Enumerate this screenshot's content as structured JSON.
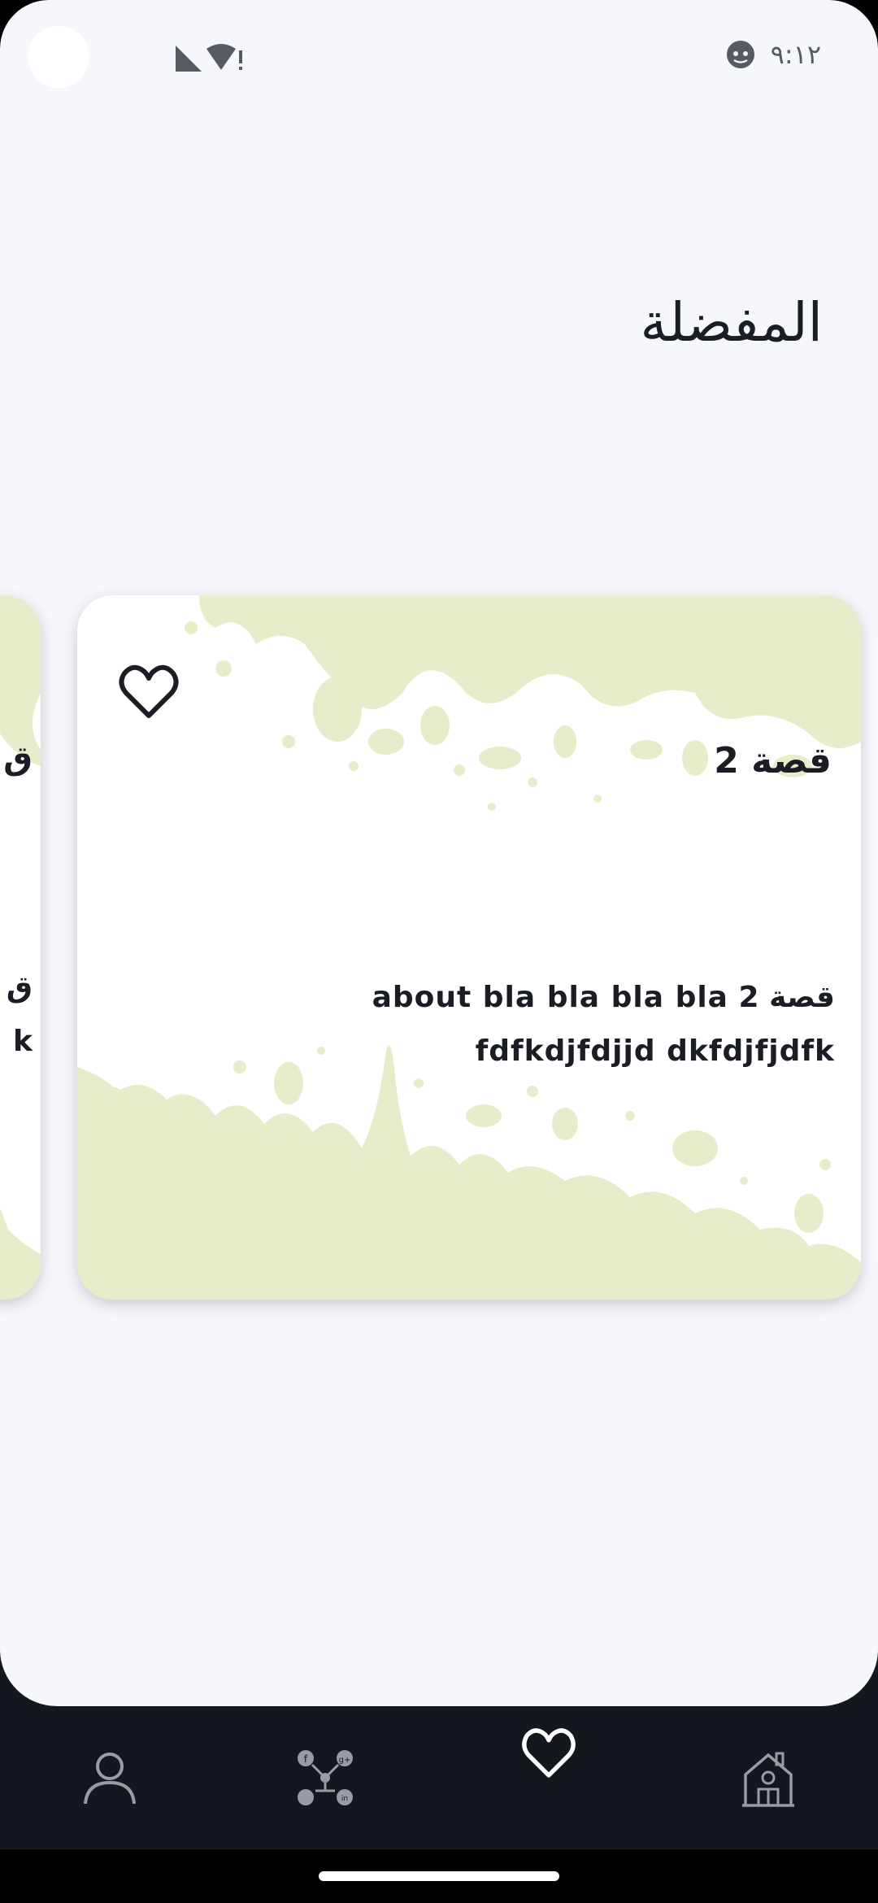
{
  "status_bar": {
    "time": "٩:١٢",
    "icons": [
      "signal-icon",
      "wifi-alert-icon",
      "face-icon"
    ]
  },
  "page": {
    "title": "المفضلة"
  },
  "cards": [
    {
      "title": "قصة 2",
      "description": "قصة 2 about bla bla bla bla fdfkdjfdjjd dkfdjfjdfk",
      "favorited": true
    }
  ],
  "peek_card": {
    "title_fragment": "ق",
    "desc_fragment_1": "ق",
    "desc_fragment_2": "k"
  },
  "bottom_nav": {
    "items": [
      {
        "icon": "profile-icon",
        "active": false
      },
      {
        "icon": "social-network-icon",
        "active": false
      },
      {
        "icon": "heart-icon",
        "active": true
      },
      {
        "icon": "home-icon",
        "active": false
      }
    ]
  },
  "colors": {
    "background": "#f6f7fc",
    "nav_background": "#14171e",
    "splash": "#e8ecca",
    "text": "#1a1d24",
    "nav_icon_inactive": "#9a9ca3",
    "nav_icon_active": "#ffffff"
  }
}
